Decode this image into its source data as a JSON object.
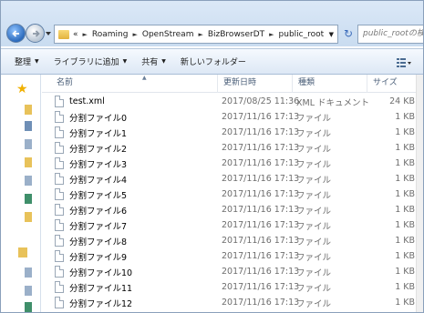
{
  "address": {
    "overflow": "«",
    "crumbs": [
      "Roaming",
      "OpenStream",
      "BizBrowserDT",
      "public_root"
    ]
  },
  "search": {
    "placeholder": "public_rootの検索"
  },
  "toolbar": {
    "organize": "整理",
    "library": "ライブラリに追加",
    "share": "共有",
    "new_folder": "新しいフォルダー"
  },
  "columns": {
    "name": "名前",
    "date": "更新日時",
    "type": "種類",
    "size": "サイズ"
  },
  "files": [
    {
      "name": "test.xml",
      "date": "2017/08/25 11:36",
      "type": "XML ドキュメント",
      "size": "24 KB"
    },
    {
      "name": "分割ファイル0",
      "date": "2017/11/16 17:13",
      "type": "ファイル",
      "size": "1 KB"
    },
    {
      "name": "分割ファイル1",
      "date": "2017/11/16 17:13",
      "type": "ファイル",
      "size": "1 KB"
    },
    {
      "name": "分割ファイル2",
      "date": "2017/11/16 17:13",
      "type": "ファイル",
      "size": "1 KB"
    },
    {
      "name": "分割ファイル3",
      "date": "2017/11/16 17:13",
      "type": "ファイル",
      "size": "1 KB"
    },
    {
      "name": "分割ファイル4",
      "date": "2017/11/16 17:13",
      "type": "ファイル",
      "size": "1 KB"
    },
    {
      "name": "分割ファイル5",
      "date": "2017/11/16 17:13",
      "type": "ファイル",
      "size": "1 KB"
    },
    {
      "name": "分割ファイル6",
      "date": "2017/11/16 17:13",
      "type": "ファイル",
      "size": "1 KB"
    },
    {
      "name": "分割ファイル7",
      "date": "2017/11/16 17:13",
      "type": "ファイル",
      "size": "1 KB"
    },
    {
      "name": "分割ファイル8",
      "date": "2017/11/16 17:13",
      "type": "ファイル",
      "size": "1 KB"
    },
    {
      "name": "分割ファイル9",
      "date": "2017/11/16 17:13",
      "type": "ファイル",
      "size": "1 KB"
    },
    {
      "name": "分割ファイル10",
      "date": "2017/11/16 17:13",
      "type": "ファイル",
      "size": "1 KB"
    },
    {
      "name": "分割ファイル11",
      "date": "2017/11/16 17:13",
      "type": "ファイル",
      "size": "1 KB"
    },
    {
      "name": "分割ファイル12",
      "date": "2017/11/16 17:13",
      "type": "ファイル",
      "size": "1 KB"
    }
  ],
  "icons": {
    "back": "back-arrow-icon",
    "forward": "forward-arrow-icon",
    "refresh": "refresh-icon",
    "favorites": "star-icon",
    "view": "view-options-icon"
  },
  "colors": {
    "chrome": "#dbe8f7",
    "toolbar": "#dde8f5",
    "secondary_text": "#6d6d6d"
  }
}
